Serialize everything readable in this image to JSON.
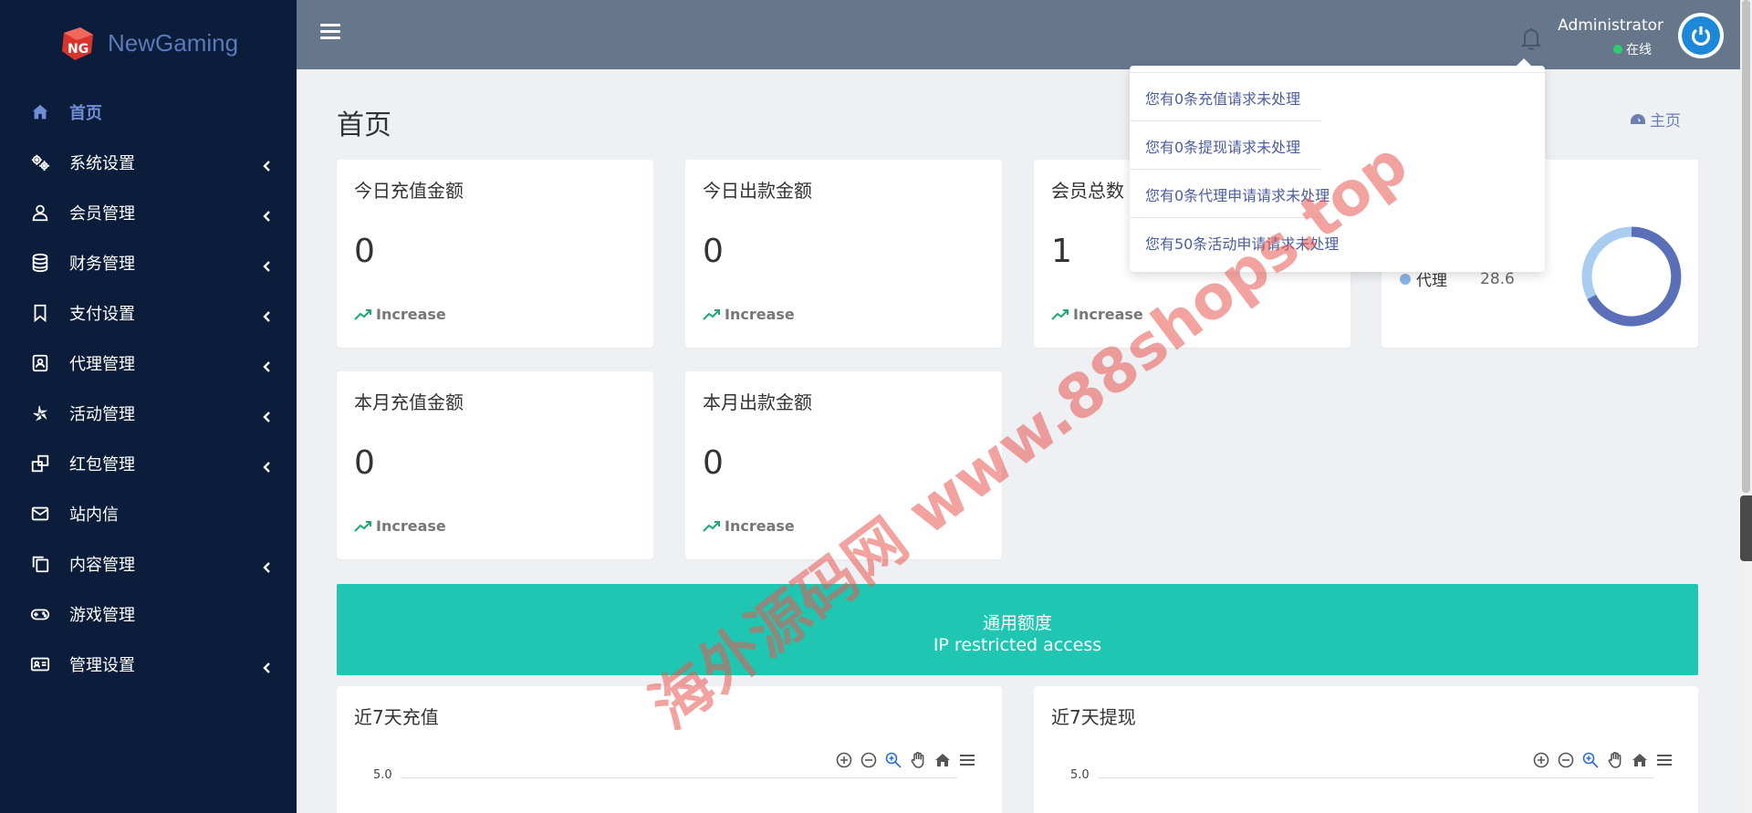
{
  "brand": {
    "name": "NewGaming"
  },
  "sidebar": {
    "items": [
      {
        "label": "首页",
        "icon": "home-icon",
        "active": true,
        "submenu": false
      },
      {
        "label": "系统设置",
        "icon": "cogs-icon",
        "submenu": true
      },
      {
        "label": "会员管理",
        "icon": "user-icon",
        "submenu": true
      },
      {
        "label": "财务管理",
        "icon": "database-icon",
        "submenu": true
      },
      {
        "label": "支付设置",
        "icon": "bookmark-icon",
        "submenu": true
      },
      {
        "label": "代理管理",
        "icon": "contact-card-icon",
        "submenu": true
      },
      {
        "label": "活动管理",
        "icon": "yelp-icon",
        "submenu": true
      },
      {
        "label": "红包管理",
        "icon": "clone-icon",
        "submenu": true
      },
      {
        "label": "站内信",
        "icon": "envelope-icon",
        "submenu": false
      },
      {
        "label": "内容管理",
        "icon": "copy-icon",
        "submenu": true
      },
      {
        "label": "游戏管理",
        "icon": "gamepad-icon",
        "submenu": false
      },
      {
        "label": "管理设置",
        "icon": "id-card-icon",
        "submenu": true
      }
    ]
  },
  "header": {
    "user_name": "Administrator",
    "user_status": "在线"
  },
  "notifications": [
    "您有0条充值请求未处理",
    "您有0条提现请求未处理",
    "您有0条代理申请请求未处理",
    "您有50条活动申请请求未处理"
  ],
  "page": {
    "title": "首页",
    "breadcrumb": "主页"
  },
  "stats": [
    {
      "title": "今日充值金额",
      "value": "0",
      "trend": "Increase"
    },
    {
      "title": "今日出款金额",
      "value": "0",
      "trend": "Increase"
    },
    {
      "title": "会员总数",
      "value": "1",
      "trend": "Increase"
    },
    {
      "title": "本月充值金额",
      "value": "0",
      "trend": "Increase"
    },
    {
      "title": "本月出款金额",
      "value": "0",
      "trend": "Increase"
    }
  ],
  "donut_card": {
    "legend_label": "代理",
    "legend_value": "28.6",
    "colors": [
      "#5b6fb8",
      "#a8cdf0"
    ]
  },
  "banner": {
    "line1": "通用额度",
    "line2": "IP restricted access",
    "color": "#1fc7b2"
  },
  "charts": [
    {
      "title": "近7天充值",
      "ytick": "5.0"
    },
    {
      "title": "近7天提现",
      "ytick": "5.0"
    }
  ],
  "watermark": "海外源码网 www.88shops.top"
}
